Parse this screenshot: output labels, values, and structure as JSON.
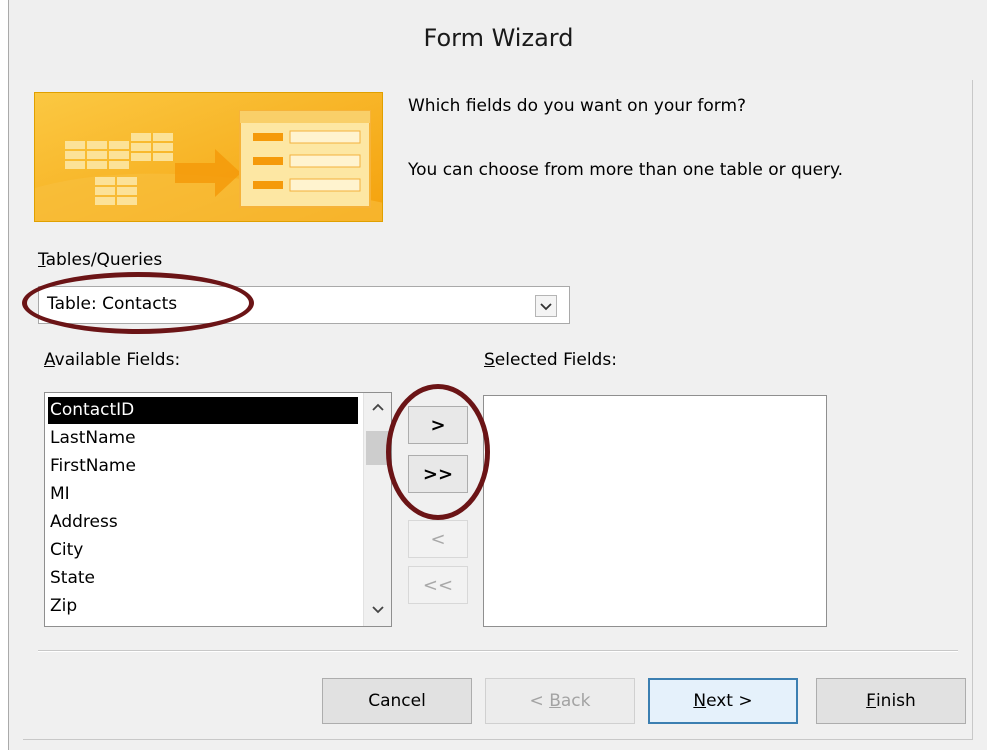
{
  "window": {
    "title": "Form Wizard"
  },
  "prompt": {
    "line1": "Which fields do you want on your form?",
    "line2": "You can choose from more than one table or query."
  },
  "tables_queries": {
    "label_accel": "T",
    "label_rest": "ables/Queries",
    "selected": "Table: Contacts"
  },
  "available_fields": {
    "label_accel": "A",
    "label_rest": "vailable Fields:",
    "items": [
      "ContactID",
      "LastName",
      "FirstName",
      "MI",
      "Address",
      "City",
      "State",
      "Zip"
    ],
    "selected_index": 0
  },
  "selected_fields": {
    "label_accel": "S",
    "label_rest": "elected Fields:",
    "items": []
  },
  "move_buttons": {
    "add_one": ">",
    "add_all": ">>",
    "remove_one": "<",
    "remove_all": "<<"
  },
  "footer": {
    "cancel": "Cancel",
    "back_prefix": "< ",
    "back_accel": "B",
    "back_rest": "ack",
    "next_accel": "N",
    "next_rest": "ext >",
    "finish_accel": "F",
    "finish_rest": "inish"
  },
  "colors": {
    "annotation": "#6b1416",
    "banner": "#f7b21d",
    "selection": "#000000"
  }
}
